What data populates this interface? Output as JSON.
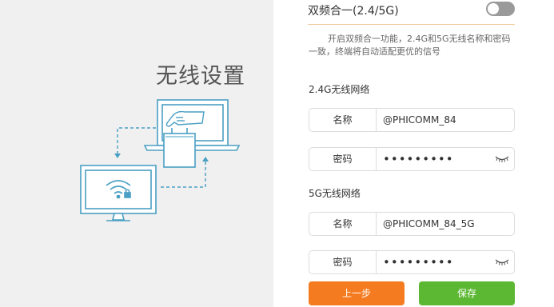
{
  "page_title": "无线设置",
  "dual_band": {
    "label": "双频合一(2.4/5G)",
    "enabled": false,
    "description": "开启双频合一功能，2.4G和5G无线名称和密码一致，终端将自动适配更优的信号"
  },
  "network_24g": {
    "title": "2.4G无线网络",
    "name_label": "名称",
    "name_value": "@PHICOMM_84",
    "password_label": "密码",
    "password_value": "•••••••••"
  },
  "network_5g": {
    "title": "5G无线网络",
    "name_label": "名称",
    "name_value": "@PHICOMM_84_5G",
    "password_label": "密码",
    "password_value": "•••••••••"
  },
  "buttons": {
    "prev_label": "上一步",
    "save_label": "保存"
  },
  "colors": {
    "prev_button": "#f47b1f",
    "save_button": "#5cb833",
    "illustration_line": "#4a9fc4"
  },
  "icons": {
    "password_toggle": "eye-closed-icon",
    "wifi": "wifi-lock-icon"
  }
}
